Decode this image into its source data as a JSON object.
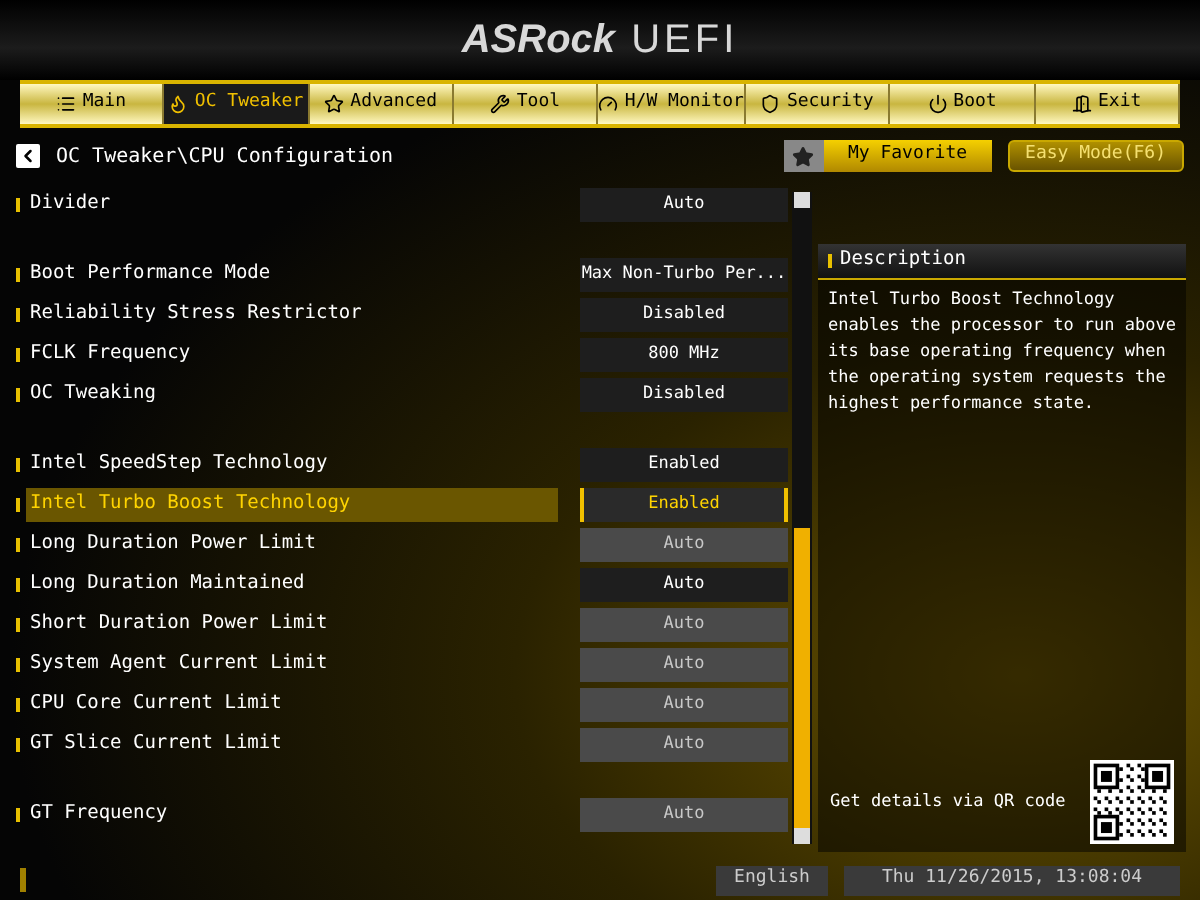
{
  "logo": {
    "brand": "ASRock",
    "product": "UEFI"
  },
  "tabs": [
    {
      "label": "Main",
      "selected": false
    },
    {
      "label": "OC Tweaker",
      "selected": true
    },
    {
      "label": "Advanced",
      "selected": false
    },
    {
      "label": "Tool",
      "selected": false
    },
    {
      "label": "H/W Monitor",
      "selected": false
    },
    {
      "label": "Security",
      "selected": false
    },
    {
      "label": "Boot",
      "selected": false
    },
    {
      "label": "Exit",
      "selected": false
    }
  ],
  "breadcrumb": "OC Tweaker\\CPU Configuration",
  "my_favorite": "My Favorite",
  "easy_mode": "Easy Mode(F6)",
  "settings": [
    [
      {
        "label": "Divider",
        "value": "Auto",
        "selected": false,
        "disabled": false
      }
    ],
    [
      {
        "label": "Boot Performance Mode",
        "value": "Max Non-Turbo Per...",
        "selected": false,
        "disabled": false
      },
      {
        "label": "Reliability Stress Restrictor",
        "value": "Disabled",
        "selected": false,
        "disabled": false
      },
      {
        "label": "FCLK Frequency",
        "value": "800 MHz",
        "selected": false,
        "disabled": false
      },
      {
        "label": "OC Tweaking",
        "value": "Disabled",
        "selected": false,
        "disabled": false
      }
    ],
    [
      {
        "label": "Intel SpeedStep Technology",
        "value": "Enabled",
        "selected": false,
        "disabled": false
      },
      {
        "label": "Intel Turbo Boost Technology",
        "value": "Enabled",
        "selected": true,
        "disabled": false
      },
      {
        "label": "Long Duration Power Limit",
        "value": "Auto",
        "selected": false,
        "disabled": true
      },
      {
        "label": "Long Duration Maintained",
        "value": "Auto",
        "selected": false,
        "disabled": false
      },
      {
        "label": "Short Duration Power Limit",
        "value": "Auto",
        "selected": false,
        "disabled": true
      },
      {
        "label": "System Agent Current Limit",
        "value": "Auto",
        "selected": false,
        "disabled": true
      },
      {
        "label": "CPU Core Current Limit",
        "value": "Auto",
        "selected": false,
        "disabled": true
      },
      {
        "label": "GT Slice Current Limit",
        "value": "Auto",
        "selected": false,
        "disabled": true
      }
    ],
    [
      {
        "label": "GT Frequency",
        "value": "Auto",
        "selected": false,
        "disabled": true
      }
    ]
  ],
  "description": {
    "title": "Description",
    "text": "Intel Turbo Boost Technology enables the processor to run above its base operating frequency  when the operating system requests the highest performance state."
  },
  "qr_caption": "Get details via QR code",
  "status_bar": {
    "language": "English",
    "datetime": "Thu 11/26/2015, 13:08:04"
  }
}
